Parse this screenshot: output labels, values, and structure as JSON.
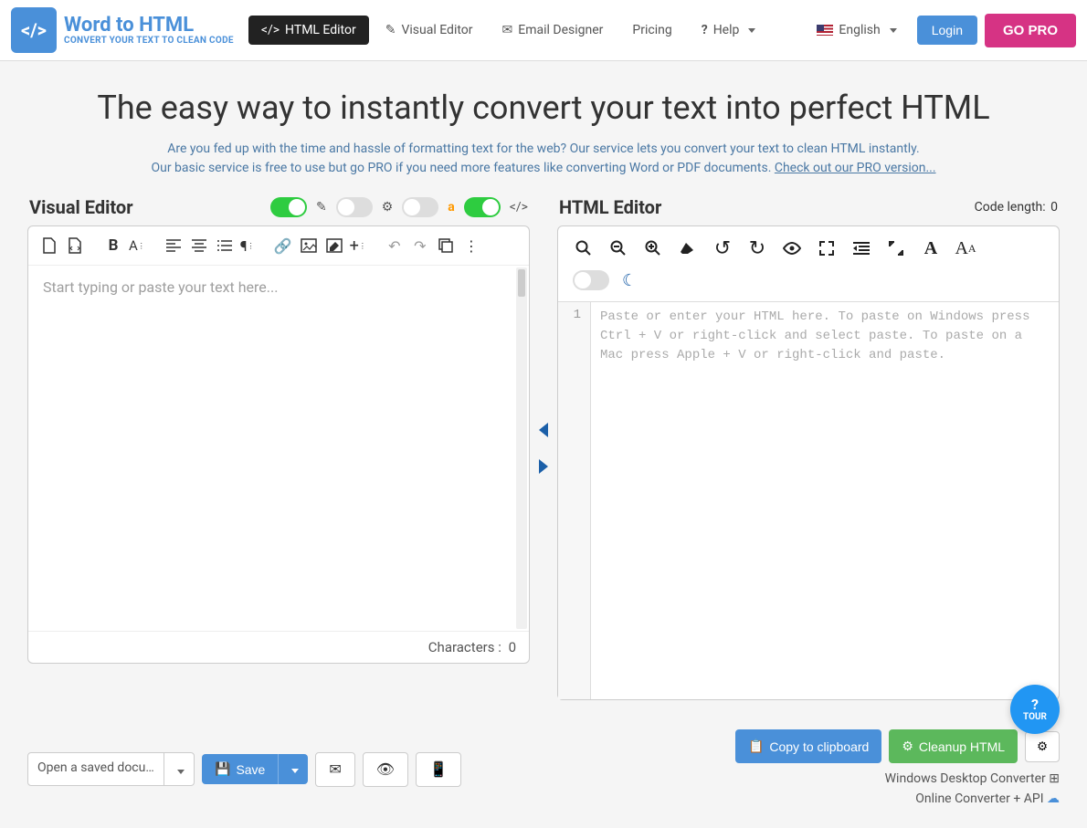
{
  "header": {
    "logo_title": "Word to HTML",
    "logo_sub": "CONVERT YOUR TEXT TO CLEAN CODE",
    "nav": {
      "html_editor": "HTML Editor",
      "visual_editor": "Visual Editor",
      "email_designer": "Email Designer",
      "pricing": "Pricing",
      "help": "Help",
      "language": "English"
    },
    "login": "Login",
    "gopro": "GO PRO"
  },
  "hero": {
    "title": "The easy way to instantly convert your text into perfect HTML",
    "line1": "Are you fed up with the time and hassle of formatting text for the web? Our service lets you convert your text to clean HTML instantly.",
    "line2_a": "Our basic service is free to use but go PRO if you need more features like converting Word or PDF documents. ",
    "line2_link": "Check out our PRO version..."
  },
  "visual": {
    "title": "Visual Editor",
    "placeholder": "Start typing or paste your text here...",
    "footer_label": "Characters :",
    "footer_count": "0"
  },
  "html": {
    "title": "HTML Editor",
    "code_length_label": "Code length:",
    "code_length": "0",
    "gutter": "1",
    "placeholder": "Paste or enter your HTML here. To paste on Windows press Ctrl + V or right-click and select paste. To paste on a Mac press Apple + V or right-click and paste."
  },
  "bottom": {
    "open_doc": "Open a saved docum...",
    "save": "Save",
    "copy": "Copy to clipboard",
    "cleanup": "Cleanup HTML"
  },
  "footer": {
    "desktop": "Windows Desktop Converter",
    "api": "Online Converter + API"
  },
  "tour": {
    "label": "TOUR",
    "q": "?"
  }
}
